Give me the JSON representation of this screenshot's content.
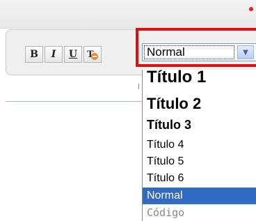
{
  "toolbar": {
    "bold_label": "B",
    "italic_label": "I",
    "underline_label": "U",
    "clear_icon": "clear-format-icon"
  },
  "format_select": {
    "value": "Normal",
    "arrow_icon": "chevron-down-icon",
    "options": [
      "Título 1",
      "Título 2",
      "Título 3",
      "Título 4",
      "Título 5",
      "Título 6",
      "Normal",
      "Código"
    ],
    "selected_color": "#316ac5"
  },
  "colors": {
    "highlight": "#e01010"
  }
}
